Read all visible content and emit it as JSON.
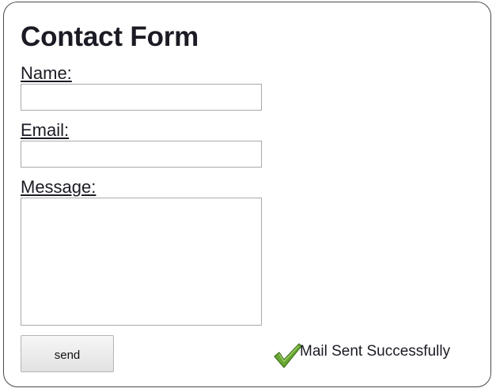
{
  "form": {
    "title": "Contact Form",
    "name_label": "Name:",
    "name_value": "",
    "email_label": "Email:",
    "email_value": "",
    "message_label": "Message:",
    "message_value": "",
    "send_label": "send"
  },
  "status": {
    "icon": "checkmark-icon",
    "text": "Mail Sent Successfully",
    "color": "#5a9a2a"
  }
}
